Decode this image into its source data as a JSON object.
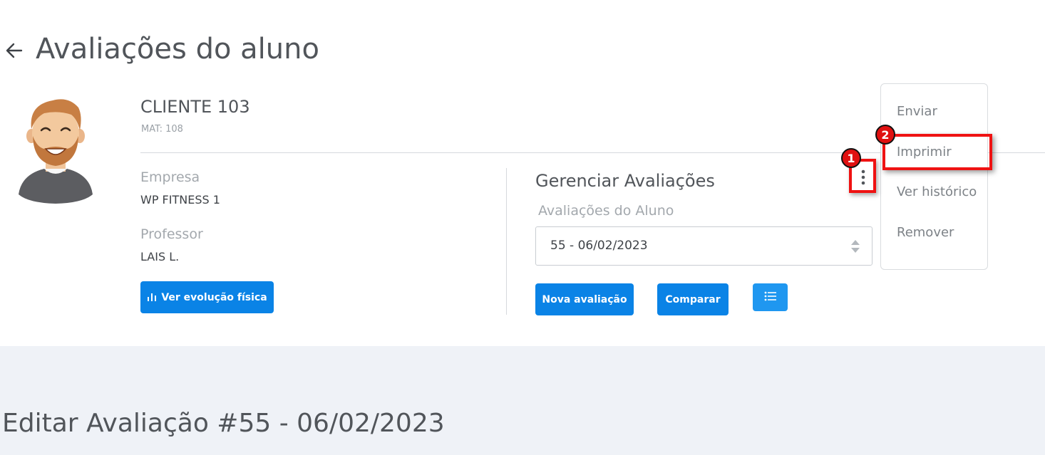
{
  "header": {
    "title": "Avaliações do aluno",
    "back_icon": "arrow-left-icon"
  },
  "client": {
    "name": "CLIENTE 103",
    "mat": "MAT: 108"
  },
  "info": {
    "empresa_label": "Empresa",
    "empresa_value": "WP FITNESS 1",
    "professor_label": "Professor",
    "professor_value": "LAIS L.",
    "evolution_button": "Ver evolução física"
  },
  "manage": {
    "title": "Gerenciar Avaliações",
    "select_label": "Avaliações do Aluno",
    "select_value": "55 - 06/02/2023",
    "new_button": "Nova avaliação",
    "compare_button": "Comparar"
  },
  "menu": {
    "items": [
      "Enviar",
      "Imprimir",
      "Ver histórico",
      "Remover"
    ]
  },
  "annotations": {
    "badge_1": "1",
    "badge_2": "2",
    "highlight_color": "#ef1212"
  },
  "edit": {
    "title": "Editar Avaliação #55 - 06/02/2023"
  },
  "colors": {
    "primary": "#0a83e6",
    "background_light": "#eff2f7",
    "text": "#51555a"
  }
}
